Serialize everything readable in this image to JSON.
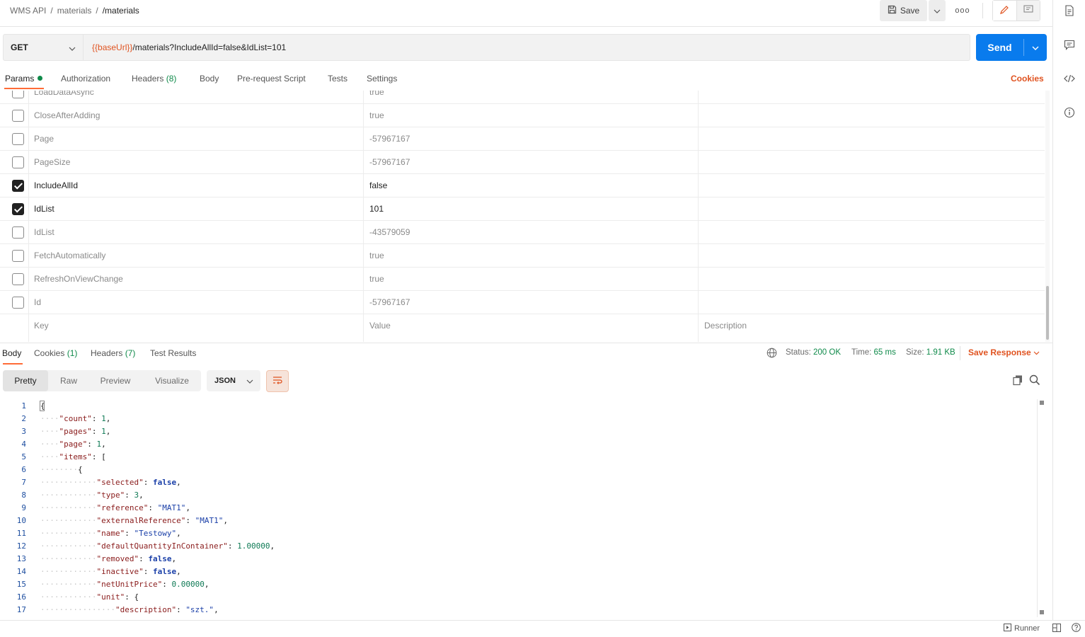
{
  "breadcrumb": {
    "root": "WMS API",
    "mid": "materials",
    "current": "/materials"
  },
  "toolbar": {
    "save_label": "Save",
    "more_label": "ooo"
  },
  "request": {
    "method": "GET",
    "url_var": "{{baseUrl}}",
    "url_rest": "/materials?IncludeAllId=false&IdList=101",
    "send_label": "Send"
  },
  "req_tabs": {
    "params": "Params",
    "authorization": "Authorization",
    "headers": "Headers",
    "headers_count": "(8)",
    "body": "Body",
    "prerequest": "Pre-request Script",
    "tests": "Tests",
    "settings": "Settings",
    "cookies": "Cookies"
  },
  "params": [
    {
      "key": "LoadDataAsync",
      "value": "true",
      "checked": false
    },
    {
      "key": "CloseAfterAdding",
      "value": "true",
      "checked": false
    },
    {
      "key": "Page",
      "value": "-57967167",
      "checked": false
    },
    {
      "key": "PageSize",
      "value": "-57967167",
      "checked": false
    },
    {
      "key": "IncludeAllId",
      "value": "false",
      "checked": true
    },
    {
      "key": "IdList",
      "value": "101",
      "checked": true
    },
    {
      "key": "IdList",
      "value": "-43579059",
      "checked": false
    },
    {
      "key": "FetchAutomatically",
      "value": "true",
      "checked": false
    },
    {
      "key": "RefreshOnViewChange",
      "value": "true",
      "checked": false
    },
    {
      "key": "Id",
      "value": "-57967167",
      "checked": false
    }
  ],
  "params_placeholder": {
    "key": "Key",
    "value": "Value",
    "description": "Description"
  },
  "resp_tabs": {
    "body": "Body",
    "cookies": "Cookies",
    "cookies_count": "(1)",
    "headers": "Headers",
    "headers_count": "(7)",
    "tests": "Test Results"
  },
  "response_meta": {
    "status_label": "Status:",
    "status_value": "200 OK",
    "time_label": "Time:",
    "time_value": "65 ms",
    "size_label": "Size:",
    "size_value": "1.91 KB",
    "save_response": "Save Response"
  },
  "view_tabs": {
    "pretty": "Pretty",
    "raw": "Raw",
    "preview": "Preview",
    "visualize": "Visualize",
    "format": "JSON"
  },
  "code_lines": [
    {
      "n": "1",
      "depth": 0,
      "parts": [
        [
          "p",
          "{"
        ]
      ]
    },
    {
      "n": "2",
      "depth": 1,
      "parts": [
        [
          "k",
          "\"count\""
        ],
        [
          "p",
          ": "
        ],
        [
          "n",
          "1"
        ],
        [
          "p",
          ","
        ]
      ]
    },
    {
      "n": "3",
      "depth": 1,
      "parts": [
        [
          "k",
          "\"pages\""
        ],
        [
          "p",
          ": "
        ],
        [
          "n",
          "1"
        ],
        [
          "p",
          ","
        ]
      ]
    },
    {
      "n": "4",
      "depth": 1,
      "parts": [
        [
          "k",
          "\"page\""
        ],
        [
          "p",
          ": "
        ],
        [
          "n",
          "1"
        ],
        [
          "p",
          ","
        ]
      ]
    },
    {
      "n": "5",
      "depth": 1,
      "parts": [
        [
          "k",
          "\"items\""
        ],
        [
          "p",
          ": ["
        ]
      ]
    },
    {
      "n": "6",
      "depth": 2,
      "parts": [
        [
          "p",
          "{"
        ]
      ]
    },
    {
      "n": "7",
      "depth": 3,
      "parts": [
        [
          "k",
          "\"selected\""
        ],
        [
          "p",
          ": "
        ],
        [
          "b",
          "false"
        ],
        [
          "p",
          ","
        ]
      ]
    },
    {
      "n": "8",
      "depth": 3,
      "parts": [
        [
          "k",
          "\"type\""
        ],
        [
          "p",
          ": "
        ],
        [
          "n",
          "3"
        ],
        [
          "p",
          ","
        ]
      ]
    },
    {
      "n": "9",
      "depth": 3,
      "parts": [
        [
          "k",
          "\"reference\""
        ],
        [
          "p",
          ": "
        ],
        [
          "s",
          "\"MAT1\""
        ],
        [
          "p",
          ","
        ]
      ]
    },
    {
      "n": "10",
      "depth": 3,
      "parts": [
        [
          "k",
          "\"externalReference\""
        ],
        [
          "p",
          ": "
        ],
        [
          "s",
          "\"MAT1\""
        ],
        [
          "p",
          ","
        ]
      ]
    },
    {
      "n": "11",
      "depth": 3,
      "parts": [
        [
          "k",
          "\"name\""
        ],
        [
          "p",
          ": "
        ],
        [
          "s",
          "\"Testowy\""
        ],
        [
          "p",
          ","
        ]
      ]
    },
    {
      "n": "12",
      "depth": 3,
      "parts": [
        [
          "k",
          "\"defaultQuantityInContainer\""
        ],
        [
          "p",
          ": "
        ],
        [
          "n",
          "1.00000"
        ],
        [
          "p",
          ","
        ]
      ]
    },
    {
      "n": "13",
      "depth": 3,
      "parts": [
        [
          "k",
          "\"removed\""
        ],
        [
          "p",
          ": "
        ],
        [
          "b",
          "false"
        ],
        [
          "p",
          ","
        ]
      ]
    },
    {
      "n": "14",
      "depth": 3,
      "parts": [
        [
          "k",
          "\"inactive\""
        ],
        [
          "p",
          ": "
        ],
        [
          "b",
          "false"
        ],
        [
          "p",
          ","
        ]
      ]
    },
    {
      "n": "15",
      "depth": 3,
      "parts": [
        [
          "k",
          "\"netUnitPrice\""
        ],
        [
          "p",
          ": "
        ],
        [
          "n",
          "0.00000"
        ],
        [
          "p",
          ","
        ]
      ]
    },
    {
      "n": "16",
      "depth": 3,
      "parts": [
        [
          "k",
          "\"unit\""
        ],
        [
          "p",
          ": {"
        ]
      ]
    },
    {
      "n": "17",
      "depth": 4,
      "parts": [
        [
          "k",
          "\"description\""
        ],
        [
          "p",
          ": "
        ],
        [
          "s",
          "\"szt.\""
        ],
        [
          "p",
          ","
        ]
      ]
    }
  ],
  "statusbar": {
    "runner": "Runner"
  },
  "colors": {
    "accent": "#ff6c37",
    "send": "#097bed",
    "success": "#0f8a4a",
    "link": "#e05320"
  }
}
